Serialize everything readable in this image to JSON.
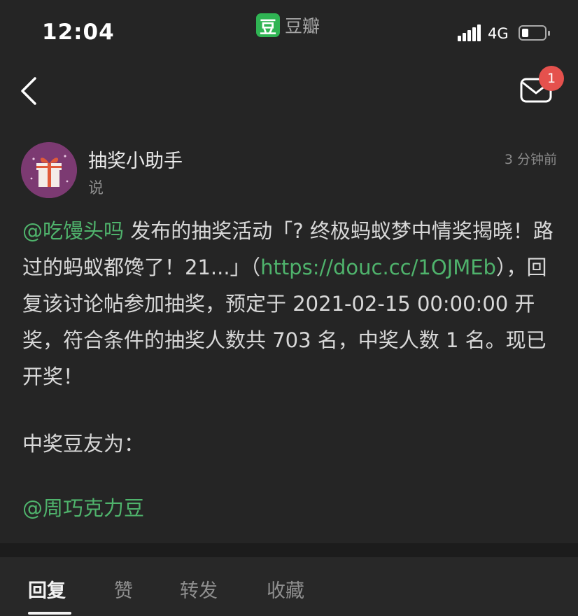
{
  "status_bar": {
    "time": "12:04",
    "app_logo": "豆",
    "app_name": "豆瓣",
    "network": "4G",
    "icons": [
      "signal-icon",
      "battery-icon"
    ]
  },
  "nav": {
    "back_icon": "chevron-left-icon",
    "mail_icon": "mail-icon",
    "unread_count": "1"
  },
  "post": {
    "author": "抽奖小助手",
    "verb": "说",
    "time": "3 分钟前",
    "body": {
      "mention": "@吃馒头吗",
      "text_a": " 发布的抽奖活动「? 终极蚂蚁梦中情奖揭晓！路过的蚂蚁都馋了！21...」（",
      "url": "https://douc.cc/1OJMEb",
      "text_b": "），回复该讨论帖参加抽奖，预定于 2021-02-15 00:00:00 开奖，符合条件的抽奖人数共 703 名，中奖人数 1 名。现已开奖！"
    },
    "winner_label": "中奖豆友为：",
    "winner": "@周巧克力豆"
  },
  "tabs": [
    {
      "label": "回复",
      "active": true
    },
    {
      "label": "赞",
      "active": false
    },
    {
      "label": "转发",
      "active": false
    },
    {
      "label": "收藏",
      "active": false
    }
  ],
  "colors": {
    "background": "#252525",
    "link": "#4fb36c",
    "badge": "#e5514d",
    "brand": "#2fb453"
  }
}
